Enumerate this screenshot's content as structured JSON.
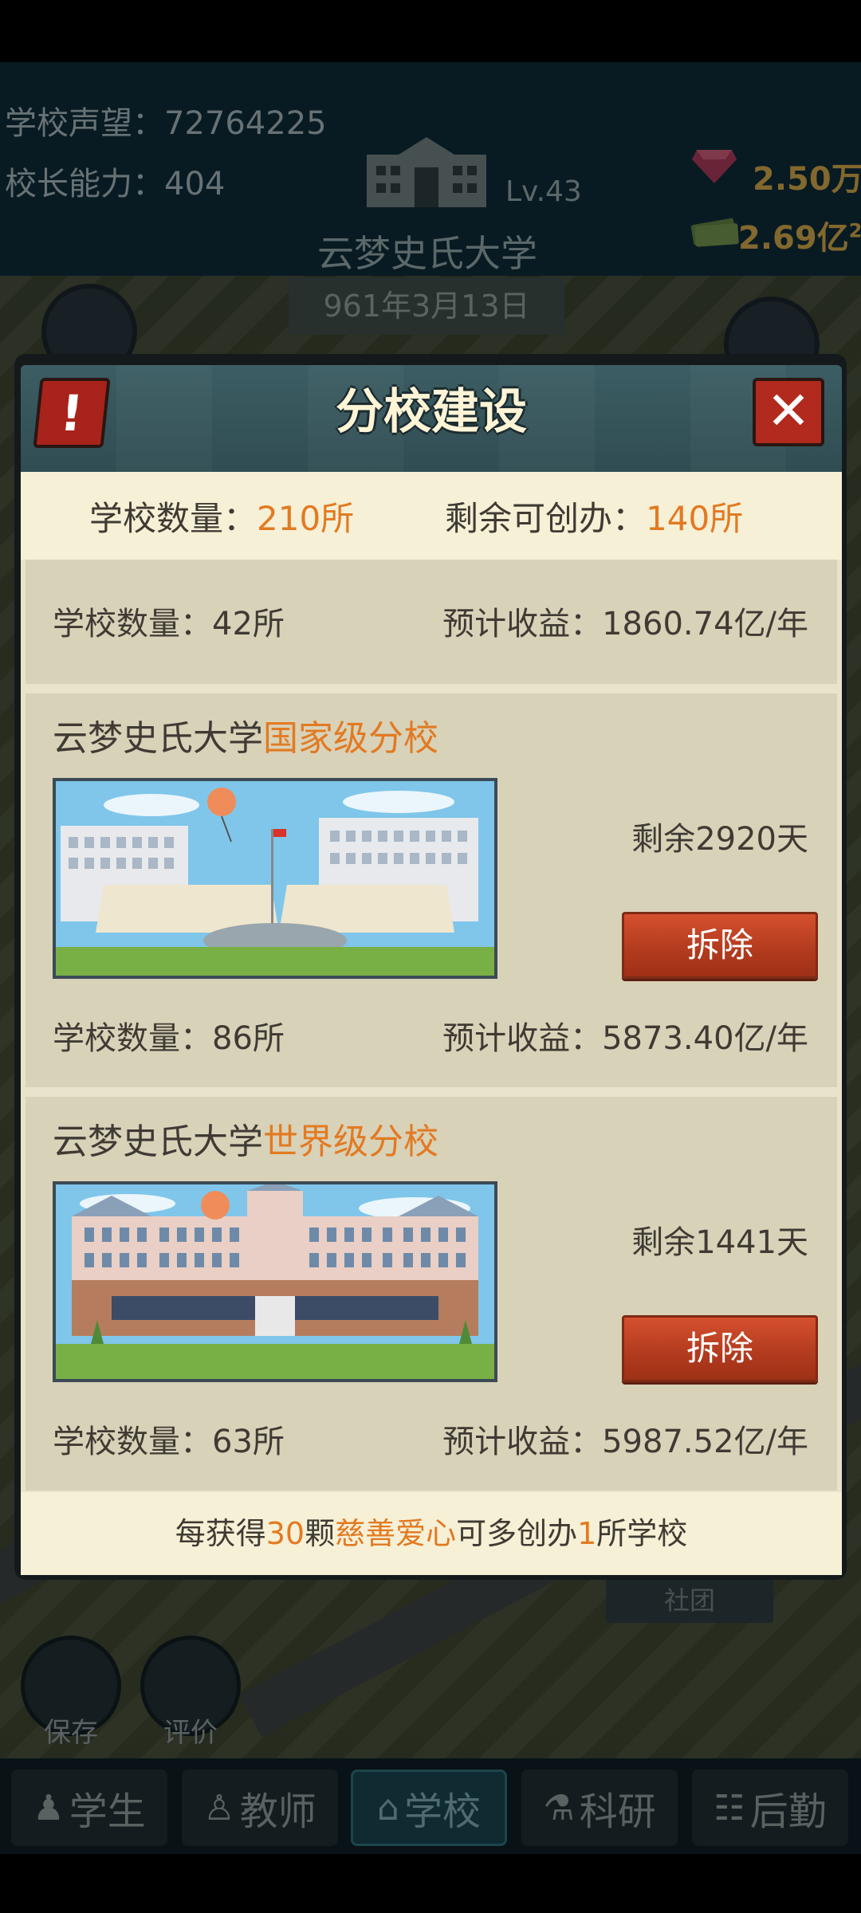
{
  "hud": {
    "prestige_label": "学校声望：",
    "prestige_value": "72764225",
    "ability_label": "校长能力：",
    "ability_value": "404",
    "school_name": "云梦史氏大学",
    "level": "Lv.43",
    "date": "961年3月13日",
    "gems": "2.50万",
    "cash": "2.69亿",
    "cash_exp": "2"
  },
  "map": {
    "save_label": "保存",
    "rate_label": "评价",
    "club_label": "社团"
  },
  "nav": {
    "tabs": [
      {
        "label": "学生",
        "icon": "student-icon"
      },
      {
        "label": "教师",
        "icon": "teacher-icon"
      },
      {
        "label": "学校",
        "icon": "school-icon",
        "active": true
      },
      {
        "label": "科研",
        "icon": "flask-icon"
      },
      {
        "label": "后勤",
        "icon": "clipboard-icon"
      }
    ]
  },
  "modal": {
    "title": "分校建设",
    "alert_icon": "!",
    "close_icon": "✕",
    "summary": {
      "count_label": "学校数量：",
      "count_value": "210所",
      "remain_label": "剩余可创办：",
      "remain_value": "140所"
    },
    "branches": [
      {
        "count": "学校数量：42所",
        "income": "预计收益：1860.74亿/年"
      },
      {
        "name_prefix": "云梦史氏大学",
        "tier": "国家级分校",
        "days": "剩余2920天",
        "button": "拆除",
        "count": "学校数量：86所",
        "income": "预计收益：5873.40亿/年"
      },
      {
        "name_prefix": "云梦史氏大学",
        "tier": "世界级分校",
        "days": "剩余1441天",
        "button": "拆除",
        "count": "学校数量：63所",
        "income": "预计收益：5987.52亿/年"
      }
    ],
    "footer": {
      "p1": "每获得",
      "n1": "30",
      "p2": "颗",
      "item": "慈善爱心",
      "p3": "可多创办",
      "n2": "1",
      "p4": "所学校"
    }
  },
  "colors": {
    "accent": "#e27a22",
    "button_red": "#b13a1e",
    "panel": "#d8d2b9",
    "panel_light": "#f6f0d6",
    "header": "#2f4b51"
  }
}
